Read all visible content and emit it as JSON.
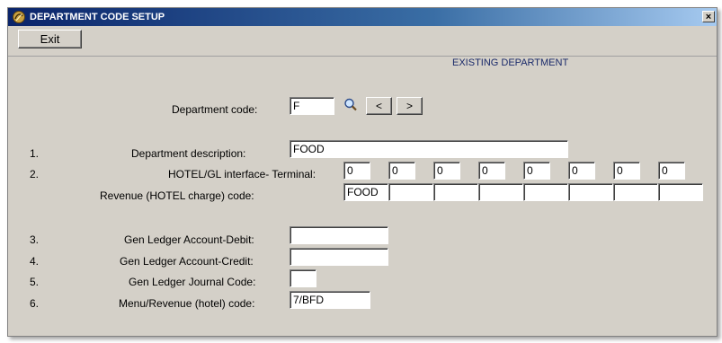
{
  "window": {
    "title": "DEPARTMENT CODE SETUP",
    "close_label": "×"
  },
  "toolbar": {
    "exit_label": "Exit"
  },
  "header": {
    "status": "EXISTING DEPARTMENT"
  },
  "dept_code": {
    "label": "Department code:",
    "value": "F",
    "prev_label": "<",
    "next_label": ">"
  },
  "rows": {
    "desc": {
      "num": "1.",
      "label": "Department description:",
      "value": "FOOD"
    },
    "terminal": {
      "num": "2.",
      "label": "HOTEL/GL interface- Terminal:",
      "values": [
        "0",
        "0",
        "0",
        "0",
        "0",
        "0",
        "0",
        "0"
      ]
    },
    "revenue": {
      "label": "Revenue (HOTEL charge) code:",
      "values": [
        "FOOD",
        "",
        "",
        "",
        "",
        "",
        "",
        ""
      ]
    },
    "gl_debit": {
      "num": "3.",
      "label": "Gen Ledger Account-Debit:",
      "value": ""
    },
    "gl_credit": {
      "num": "4.",
      "label": "Gen Ledger Account-Credit:",
      "value": ""
    },
    "gl_journal": {
      "num": "5.",
      "label": "Gen Ledger Journal Code:",
      "value": ""
    },
    "menu_rev": {
      "num": "6.",
      "label": "Menu/Revenue (hotel) code:",
      "value": "7/BFD"
    }
  },
  "colors": {
    "window_bg": "#d4d0c8",
    "titlebar_start": "#0a246a",
    "titlebar_end": "#a6caf0",
    "header_text": "#1a2a6a"
  },
  "icons": {
    "app": "app-logo-icon",
    "search": "magnifier-search-icon"
  }
}
